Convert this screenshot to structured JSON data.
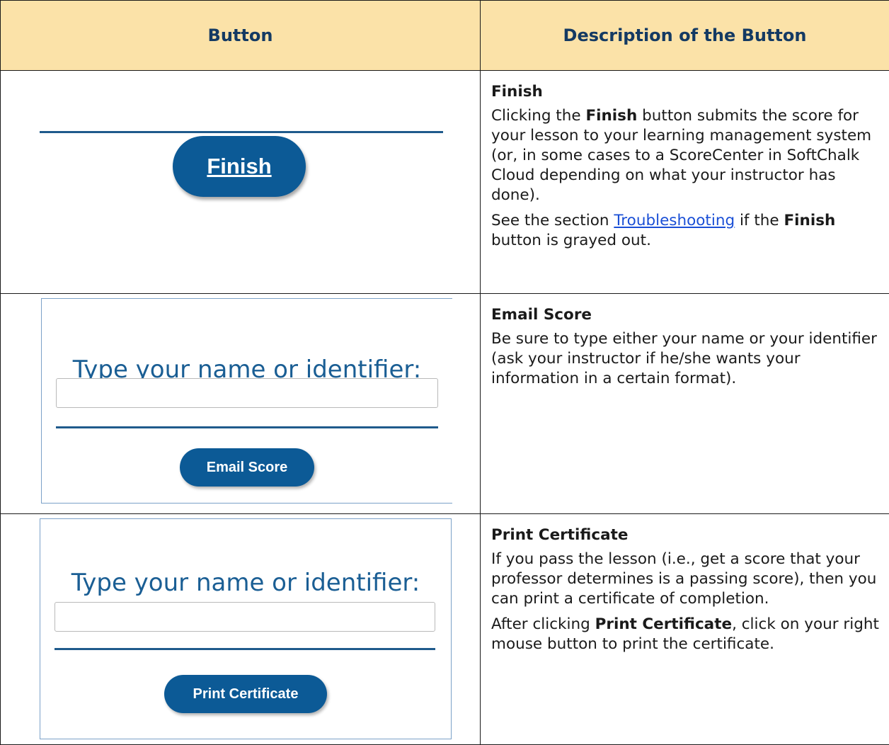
{
  "header": {
    "col_button": "Button",
    "col_description": "Description of the Button"
  },
  "rows": [
    {
      "title": "Finish",
      "button_label": "Finish",
      "p1_before": "Clicking the ",
      "p1_bold": "Finish",
      "p1_after": " button submits the score for your lesson to your learning management system (or, in some cases to a ScoreCenter in SoftChalk Cloud depending on what your instructor has done).",
      "p2_before": "See the section ",
      "p2_link": "Troubleshooting",
      "p2_middle": " if the ",
      "p2_bold": "Finish",
      "p2_after": " button is grayed out."
    },
    {
      "title": "Email Score",
      "panel_title": "Type your name or identifier:",
      "button_label": "Email Score",
      "p1": "Be sure to type either your name or your identifier (ask your instructor if he/she wants your information in a certain format)."
    },
    {
      "title": "Print Certificate",
      "panel_title": "Type your name or identifier:",
      "button_label": "Print Certificate",
      "p1": "If you pass the lesson (i.e., get a score that your professor determines is a passing score), then you can print a certificate of completion.",
      "p2_before": "After clicking ",
      "p2_bold": "Print Certificate",
      "p2_after": ", click on your right mouse button to print the certificate."
    }
  ]
}
